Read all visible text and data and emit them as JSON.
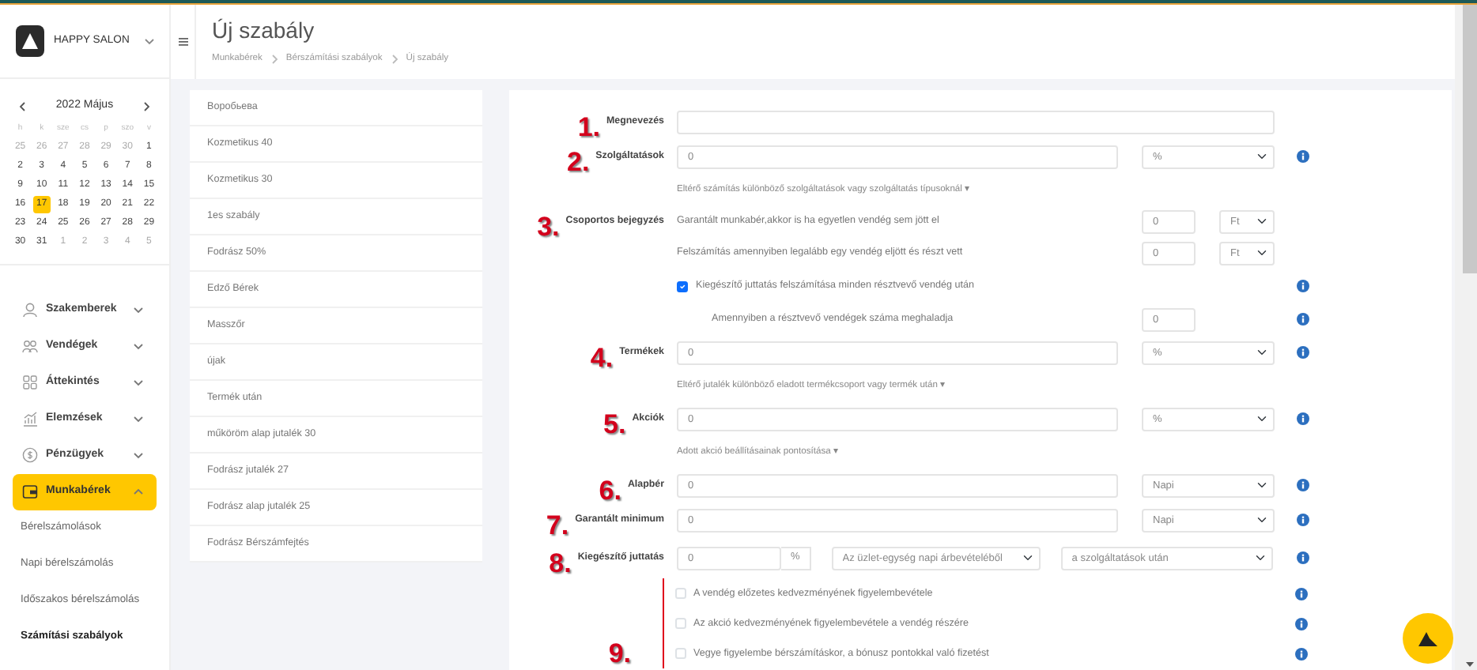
{
  "brand": {
    "name": "HAPPY SALON"
  },
  "header": {
    "title": "Új szabály",
    "breadcrumb": [
      "Munkabérek",
      "Bérszámítási szabályok",
      "Új szabály"
    ]
  },
  "calendar": {
    "title": "2022 Május",
    "weekdays": [
      "h",
      "k",
      "sze",
      "cs",
      "p",
      "szo",
      "v"
    ],
    "weeks": [
      [
        {
          "day": "25",
          "muted": true,
          "selected": false
        },
        {
          "day": "26",
          "muted": true,
          "selected": false
        },
        {
          "day": "27",
          "muted": true,
          "selected": false
        },
        {
          "day": "28",
          "muted": true,
          "selected": false
        },
        {
          "day": "29",
          "muted": true,
          "selected": false
        },
        {
          "day": "30",
          "muted": true,
          "selected": false
        },
        {
          "day": "1",
          "muted": false,
          "selected": false
        }
      ],
      [
        {
          "day": "2",
          "muted": false,
          "selected": false
        },
        {
          "day": "3",
          "muted": false,
          "selected": false
        },
        {
          "day": "4",
          "muted": false,
          "selected": false
        },
        {
          "day": "5",
          "muted": false,
          "selected": false
        },
        {
          "day": "6",
          "muted": false,
          "selected": false
        },
        {
          "day": "7",
          "muted": false,
          "selected": false
        },
        {
          "day": "8",
          "muted": false,
          "selected": false
        }
      ],
      [
        {
          "day": "9",
          "muted": false,
          "selected": false
        },
        {
          "day": "10",
          "muted": false,
          "selected": false
        },
        {
          "day": "11",
          "muted": false,
          "selected": false
        },
        {
          "day": "12",
          "muted": false,
          "selected": false
        },
        {
          "day": "13",
          "muted": false,
          "selected": false
        },
        {
          "day": "14",
          "muted": false,
          "selected": false
        },
        {
          "day": "15",
          "muted": false,
          "selected": false
        }
      ],
      [
        {
          "day": "16",
          "muted": false,
          "selected": false
        },
        {
          "day": "17",
          "muted": false,
          "selected": true
        },
        {
          "day": "18",
          "muted": false,
          "selected": false
        },
        {
          "day": "19",
          "muted": false,
          "selected": false
        },
        {
          "day": "20",
          "muted": false,
          "selected": false
        },
        {
          "day": "21",
          "muted": false,
          "selected": false
        },
        {
          "day": "22",
          "muted": false,
          "selected": false
        }
      ],
      [
        {
          "day": "23",
          "muted": false,
          "selected": false
        },
        {
          "day": "24",
          "muted": false,
          "selected": false
        },
        {
          "day": "25",
          "muted": false,
          "selected": false
        },
        {
          "day": "26",
          "muted": false,
          "selected": false
        },
        {
          "day": "27",
          "muted": false,
          "selected": false
        },
        {
          "day": "28",
          "muted": false,
          "selected": false
        },
        {
          "day": "29",
          "muted": false,
          "selected": false
        }
      ],
      [
        {
          "day": "30",
          "muted": false,
          "selected": false
        },
        {
          "day": "31",
          "muted": false,
          "selected": false
        },
        {
          "day": "1",
          "muted": true,
          "selected": false
        },
        {
          "day": "2",
          "muted": true,
          "selected": false
        },
        {
          "day": "3",
          "muted": true,
          "selected": false
        },
        {
          "day": "4",
          "muted": true,
          "selected": false
        },
        {
          "day": "5",
          "muted": true,
          "selected": false
        }
      ]
    ]
  },
  "nav": [
    {
      "label": "Szakemberek",
      "selected": false,
      "expanded": false
    },
    {
      "label": "Vendégek",
      "selected": false,
      "expanded": false
    },
    {
      "label": "Áttekintés",
      "selected": false,
      "expanded": false
    },
    {
      "label": "Elemzések",
      "selected": false,
      "expanded": false
    },
    {
      "label": "Pénzügyek",
      "selected": false,
      "expanded": false
    },
    {
      "label": "Munkabérek",
      "selected": true,
      "expanded": true,
      "children": [
        {
          "label": "Bérelszámolások",
          "selected": false
        },
        {
          "label": "Napi bérelszámolás",
          "selected": false
        },
        {
          "label": "Időszakos bérelszámolás",
          "selected": false
        },
        {
          "label": "Számítási szabályok",
          "selected": true
        }
      ]
    }
  ],
  "rules": [
    {
      "label": "Воробьева",
      "selected": false
    },
    {
      "label": "Kozmetikus 40",
      "selected": false
    },
    {
      "label": "Kozmetikus 30",
      "selected": false
    },
    {
      "label": "1es szabály",
      "selected": false
    },
    {
      "label": "Fodrász 50%",
      "selected": false
    },
    {
      "label": "Edző Bérek",
      "selected": false
    },
    {
      "label": "Masszőr",
      "selected": false
    },
    {
      "label": "újak",
      "selected": false
    },
    {
      "label": "Termék után",
      "selected": false
    },
    {
      "label": "műköröm alap jutalék 30",
      "selected": false
    },
    {
      "label": "Fodrász jutalék 27",
      "selected": false
    },
    {
      "label": "Fodrász alap jutalék 25",
      "selected": false
    },
    {
      "label": "Fodrász Bérszámfejtés",
      "selected": false
    }
  ],
  "form": [
    {
      "kind": "text",
      "marker": "1.",
      "label": "Megnevezés"
    },
    {
      "kind": "field",
      "marker": "2.",
      "label": "Szolgáltatások",
      "value": "0",
      "unit": "%",
      "info": true
    },
    {
      "kind": "hint",
      "text": "Eltérő számítás különböző szolgáltatások vagy szolgáltatás típusoknál ▾"
    },
    {
      "kind": "group",
      "marker": "3.",
      "label": "Csoportos bejegyzés",
      "text": "Garantált munkabér,akkor is ha egyetlen vendég sem jött el",
      "value": "0",
      "unit": "Ft"
    },
    {
      "kind": "group",
      "text": "Felszámítás amennyiben legalább egy vendég eljött és részt vett",
      "value": "0",
      "unit": "Ft"
    },
    {
      "kind": "check",
      "text": "Kiegészítő juttatás felszámítása minden résztvevő vendég után",
      "checked": true,
      "info": true
    },
    {
      "kind": "threshold",
      "text": "Amennyiben a résztvevő vendégek száma meghaladja",
      "value": "0",
      "info": true
    },
    {
      "kind": "field",
      "marker": "4.",
      "label": "Termékek",
      "value": "0",
      "unit": "%",
      "info": true
    },
    {
      "kind": "hint",
      "text": "Eltérő jutalék különböző eladott termékcsoport vagy termék után ▾"
    },
    {
      "kind": "field",
      "marker": "5.",
      "label": "Akciók",
      "value": "0",
      "unit": "%",
      "info": true
    },
    {
      "kind": "hint",
      "text": "Adott akció beállításainak pontosítása ▾"
    },
    {
      "kind": "field",
      "marker": "6.",
      "label": "Alapbér",
      "value": "0",
      "unit": "Napi",
      "info": true
    },
    {
      "kind": "field",
      "marker": "7.",
      "label": "Garantált minimum",
      "value": "0",
      "unit": "Napi",
      "info": true
    },
    {
      "kind": "combo",
      "marker": "8.",
      "label": "Kiegészítő juttatás",
      "value": "0",
      "addon": "%",
      "source": "Az üzlet-egység napi árbevételéből",
      "basis": "a szolgáltatások után",
      "info": true
    },
    {
      "kind": "options",
      "marker": "9.",
      "items": [
        {
          "text": "A vendég előzetes kedvezményének figyelembevétele",
          "checked": false,
          "info": true
        },
        {
          "text": "Az akció kedvezményének figyelembevétele a vendég részére",
          "checked": false,
          "info": true
        },
        {
          "text": "Vegye figyelembe bérszámításkor, a bónusz pontokkal való fizetést",
          "checked": false,
          "info": true
        }
      ]
    }
  ]
}
